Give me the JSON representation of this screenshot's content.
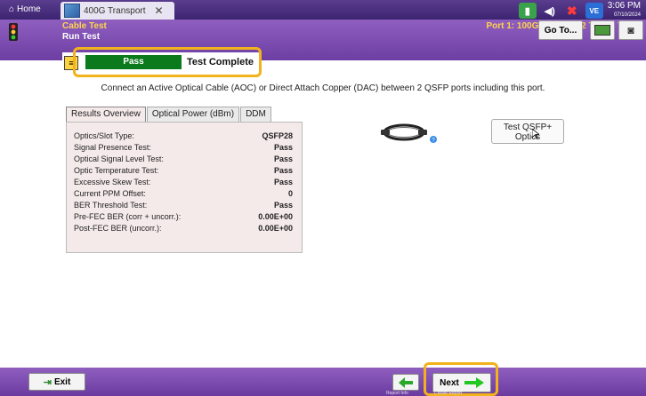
{
  "topbar": {
    "home_label": "Home",
    "tab_label": "400G Transport",
    "time": "3:06 PM",
    "date": "07/10/2024",
    "v_badge": "VE"
  },
  "header": {
    "title": "Cable Test",
    "subtitle": "Run Test",
    "port": "Port 1: 100GigE Layer 2 Traffic Term",
    "goto_label": "Go To..."
  },
  "status": {
    "result": "Pass",
    "state": "Test Complete"
  },
  "instruction": "Connect an Active Optical Cable (AOC) or Direct Attach Copper (DAC) between 2 QSFP ports including this port.",
  "tabs": [
    "Results Overview",
    "Optical Power (dBm)",
    "DDM"
  ],
  "results": [
    {
      "label": "Optics/Slot Type:",
      "value": "QSFP28"
    },
    {
      "label": "Signal Presence Test:",
      "value": "Pass"
    },
    {
      "label": "Optical Signal Level Test:",
      "value": "Pass"
    },
    {
      "label": "Optic Temperature Test:",
      "value": "Pass"
    },
    {
      "label": "Excessive Skew Test:",
      "value": "Pass"
    },
    {
      "label": "Current PPM Offset:",
      "value": "0"
    },
    {
      "label": "BER Threshold Test:",
      "value": "Pass"
    },
    {
      "label": "Pre-FEC BER (corr + uncorr.):",
      "value": "0.00E+00"
    },
    {
      "label": "Post-FEC BER (uncorr.):",
      "value": "0.00E+00"
    }
  ],
  "qsfp_button": {
    "line1": "Test QSFP+",
    "line2": "Optics"
  },
  "footer": {
    "exit_label": "Exit",
    "report_info": "Report Info",
    "next_label": "Next",
    "create_report": "Create Report"
  },
  "colors": {
    "pass_green": "#0a7a1c",
    "highlight": "#f2b21b",
    "accent_purple": "#7b4bb0"
  }
}
